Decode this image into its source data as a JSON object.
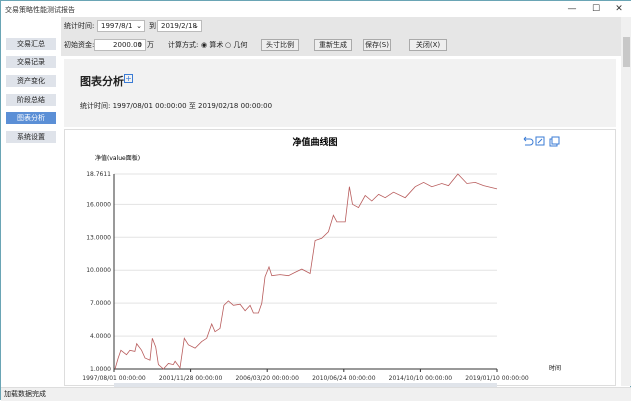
{
  "window": {
    "title": "交易策略性能测试报告",
    "minimize": "—",
    "maximize": "☐",
    "close": "✕"
  },
  "toolbar": {
    "period_label": "统计时间:",
    "start_date": "1997/8/1",
    "to_label": "到",
    "end_date": "2019/2/18",
    "capital_label": "初始资金:",
    "capital_value": "2000.00",
    "capital_unit": "万",
    "calc_label": "计算方式:",
    "calc_options": [
      "算术",
      "几何"
    ],
    "calc_selected": "算术",
    "btn_scale": "头寸比例",
    "btn_regen": "重新生成",
    "btn_save": "保存(S)",
    "btn_close": "关闭(X)"
  },
  "sidebar": {
    "items": [
      {
        "label": "交易汇总"
      },
      {
        "label": "交易记录"
      },
      {
        "label": "资产变化"
      },
      {
        "label": "阶段总结"
      },
      {
        "label": "图表分析",
        "active": true
      },
      {
        "label": "系统设置"
      }
    ]
  },
  "header": {
    "title": "图表分析",
    "period_text": "统计时间: 1997/08/01 00:00:00 至 2019/02/18 00:00:00"
  },
  "status": "加载数据完成",
  "chart_data": {
    "type": "line",
    "title": "净值曲线图",
    "ylabel": "净值(value面板)",
    "xlabel": "时间",
    "ylim": [
      1.0,
      18.7611
    ],
    "yticks": [
      "1.0000",
      "4.0000",
      "7.0000",
      "10.0000",
      "13.0000",
      "16.0000",
      "18.7611"
    ],
    "xlim": [
      "1997/08/01",
      "2019/02/18"
    ],
    "xticks": [
      "1997/08/01 00:00:00",
      "2001/11/28 00:00:00",
      "2006/03/20 00:00:00",
      "2010/06/24 00:00:00",
      "2014/10/10 00:00:00",
      "2019/01/10 00:00:00"
    ],
    "grid": true,
    "line_color": "#b85c5c",
    "toolbox_icons": [
      "restore-icon",
      "zoom-icon",
      "save-image-icon"
    ],
    "points": [
      [
        "1997/08/22",
        1.0
      ],
      [
        "1997/10/27",
        2.0
      ],
      [
        "1997/12/20",
        2.7
      ],
      [
        "1998/04/15",
        2.3
      ],
      [
        "1998/06/24",
        2.7
      ],
      [
        "1998/10/05",
        2.6
      ],
      [
        "1998/11/10",
        3.3
      ],
      [
        "1999/02/20",
        2.7
      ],
      [
        "1999/04/30",
        2.0
      ],
      [
        "1999/08/10",
        1.8
      ],
      [
        "1999/09/27",
        3.8
      ],
      [
        "1999/12/05",
        3.0
      ],
      [
        "2000/01/30",
        1.4
      ],
      [
        "2000/05/12",
        1.0
      ],
      [
        "2000/08/22",
        1.5
      ],
      [
        "2000/12/02",
        1.4
      ],
      [
        "2001/01/07",
        1.7
      ],
      [
        "2001/04/19",
        1.1
      ],
      [
        "2001/07/16",
        3.8
      ],
      [
        "2001/10/08",
        3.2
      ],
      [
        "2002/02/22",
        2.9
      ],
      [
        "2002/07/08",
        3.5
      ],
      [
        "2002/10/20",
        3.8
      ],
      [
        "2003/01/30",
        5.1
      ],
      [
        "2003/04/08",
        4.4
      ],
      [
        "2003/07/20",
        4.7
      ],
      [
        "2003/10/08",
        6.8
      ],
      [
        "2004/01/07",
        7.2
      ],
      [
        "2004/04/20",
        6.8
      ],
      [
        "2004/09/05",
        6.9
      ],
      [
        "2004/12/17",
        6.3
      ],
      [
        "2005/03/28",
        6.8
      ],
      [
        "2005/06/05",
        6.1
      ],
      [
        "2005/09/16",
        6.1
      ],
      [
        "2005/11/24",
        7.0
      ],
      [
        "2006/01/30",
        9.4
      ],
      [
        "2006/04/22",
        10.3
      ],
      [
        "2006/06/18",
        9.5
      ],
      [
        "2006/12/06",
        9.6
      ],
      [
        "2007/05/26",
        9.5
      ],
      [
        "2007/10/08",
        9.8
      ],
      [
        "2008/02/24",
        10.1
      ],
      [
        "2008/08/14",
        9.7
      ],
      [
        "2008/11/24",
        12.7
      ],
      [
        "2009/04/08",
        12.9
      ],
      [
        "2009/08/25",
        13.5
      ],
      [
        "2009/12/05",
        15.0
      ],
      [
        "2010/02/14",
        14.4
      ],
      [
        "2010/08/04",
        14.4
      ],
      [
        "2010/10/30",
        17.6
      ],
      [
        "2011/01/01",
        16.0
      ],
      [
        "2011/05/05",
        15.7
      ],
      [
        "2011/09/20",
        16.8
      ],
      [
        "2012/02/03",
        16.3
      ],
      [
        "2012/06/20",
        16.9
      ],
      [
        "2012/11/03",
        16.6
      ],
      [
        "2013/04/23",
        17.1
      ],
      [
        "2013/12/20",
        16.6
      ],
      [
        "2014/07/12",
        17.6
      ],
      [
        "2015/01/01",
        18.0
      ],
      [
        "2015/06/20",
        17.6
      ],
      [
        "2016/01/10",
        17.9
      ],
      [
        "2016/05/28",
        17.7
      ],
      [
        "2016/12/06",
        18.76
      ],
      [
        "2017/06/10",
        17.9
      ],
      [
        "2017/11/28",
        18.0
      ],
      [
        "2018/05/18",
        17.7
      ],
      [
        "2019/02/18",
        17.4
      ]
    ]
  }
}
